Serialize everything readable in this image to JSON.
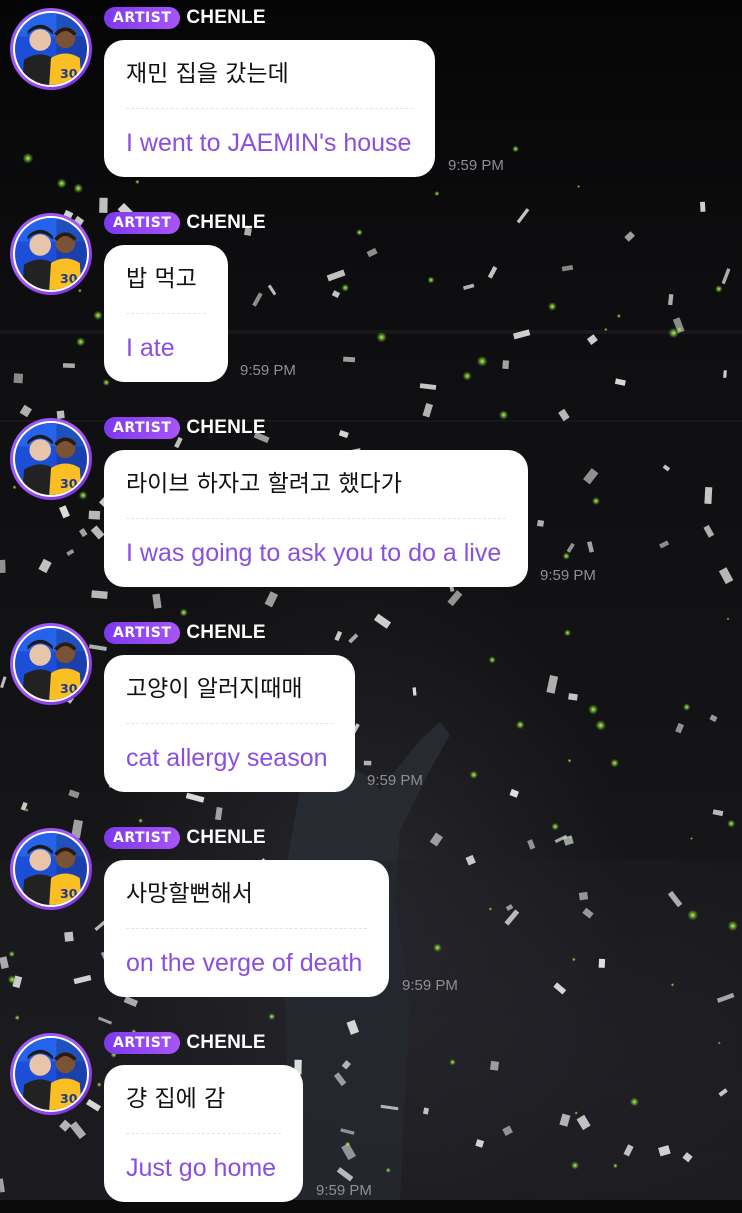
{
  "chat": {
    "messages": [
      {
        "badge": "ARTIST",
        "sender": "CHENLE",
        "text": "재민 집을 갔는데",
        "translation": "I went to JAEMIN's house",
        "time": "9:59 PM"
      },
      {
        "badge": "ARTIST",
        "sender": "CHENLE",
        "text": "밥 먹고",
        "translation": "I ate",
        "time": "9:59 PM"
      },
      {
        "badge": "ARTIST",
        "sender": "CHENLE",
        "text": "라이브 하자고 할려고 했다가",
        "translation": "I was going to ask you to do a live",
        "time": "9:59 PM"
      },
      {
        "badge": "ARTIST",
        "sender": "CHENLE",
        "text": "고양이 알러지때매",
        "translation": "cat allergy season",
        "time": "9:59 PM"
      },
      {
        "badge": "ARTIST",
        "sender": "CHENLE",
        "text": "사망할뻔해서",
        "translation": "on the verge of death",
        "time": "9:59 PM"
      },
      {
        "badge": "ARTIST",
        "sender": "CHENLE",
        "text": "걍 집에 감",
        "translation": "Just go home",
        "time": "9:59 PM"
      }
    ]
  },
  "colors": {
    "badge": "#7c3aed",
    "translation_text": "#8b4fe0",
    "avatar_ring": "#8b5cf6",
    "timestamp": "#8e8e93"
  },
  "icons": {
    "avatar": "profile-photo"
  }
}
